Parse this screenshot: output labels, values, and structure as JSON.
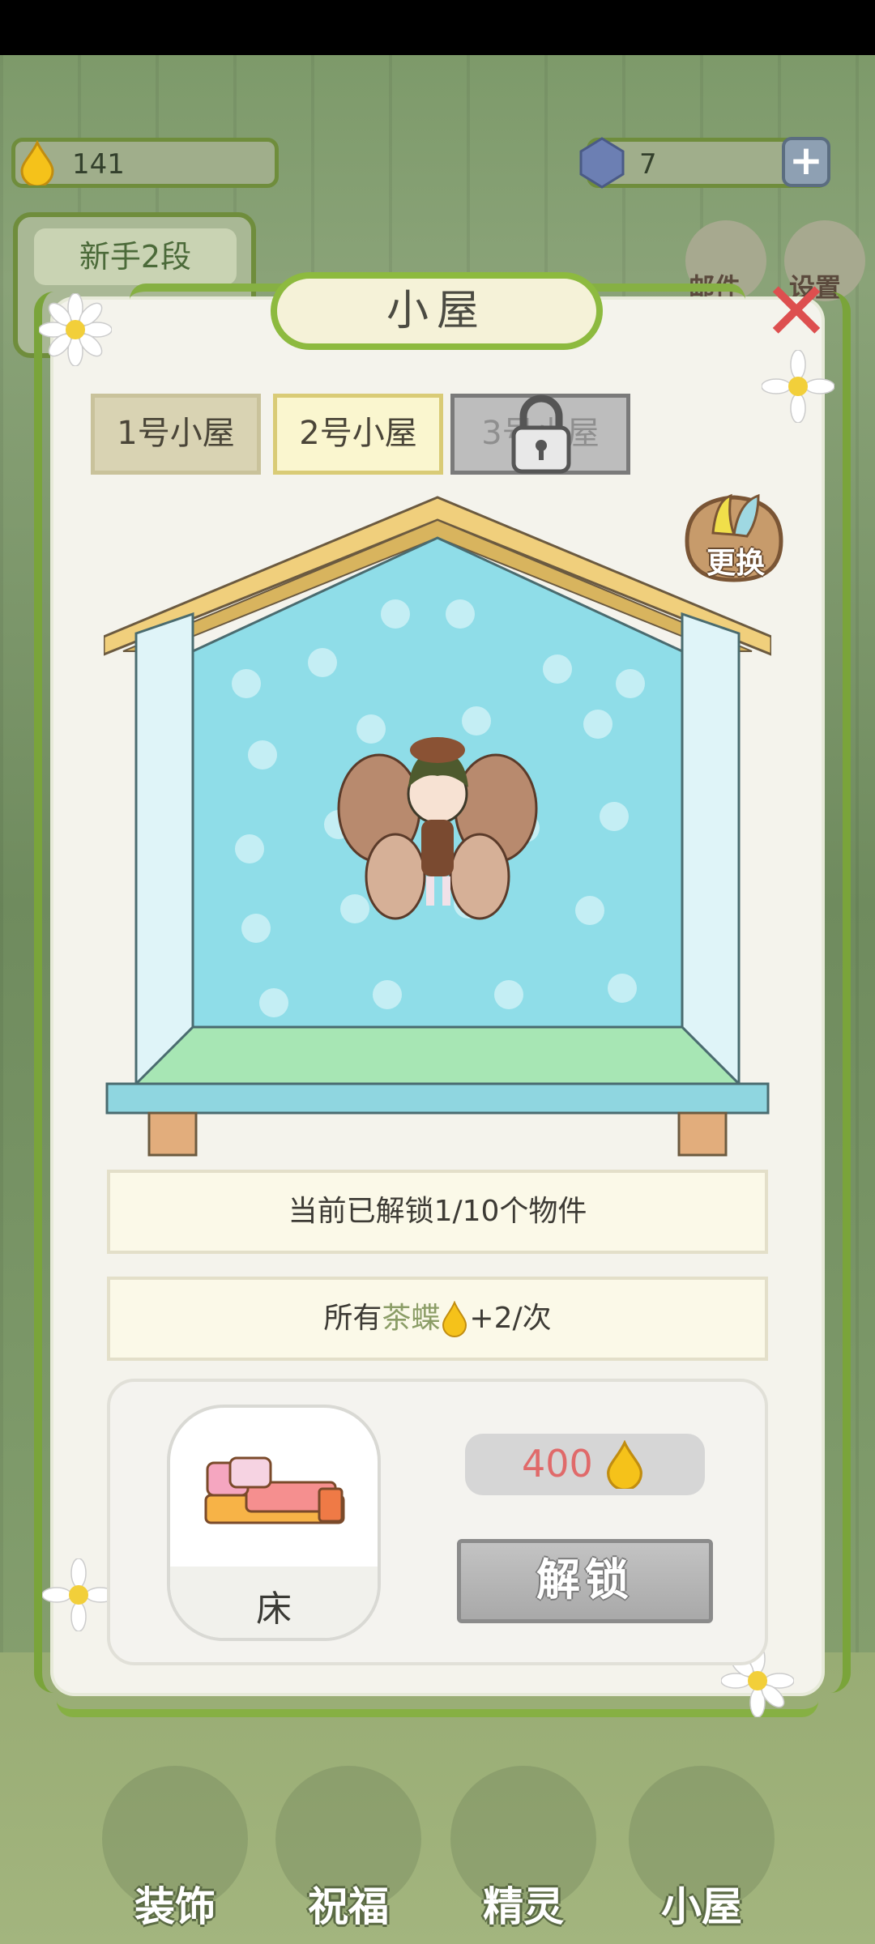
{
  "hud": {
    "drops": "141",
    "gems": "7",
    "rank_title": "新手2段"
  },
  "top_icons": [
    {
      "label": "邮件",
      "icon": "mail-icon"
    },
    {
      "label": "设置",
      "icon": "gear-icon"
    }
  ],
  "panel": {
    "title": "小屋",
    "tabs": [
      "1号小屋",
      "2号小屋",
      "3号小屋"
    ],
    "swap_label": "更换",
    "unlock_progress": "当前已解锁1/10个物件",
    "bonus_prefix": "所有",
    "bonus_highlight": "茶蝶",
    "bonus_suffix": "+2/次",
    "item": {
      "name": "床",
      "price": "400",
      "unlock_label": "解锁"
    }
  },
  "bottom_nav": [
    "装饰",
    "祝福",
    "精灵",
    "小屋"
  ],
  "colors": {
    "vine": "#7aa43a",
    "price": "#e06a6a",
    "house_wall": "#8fdde8"
  }
}
